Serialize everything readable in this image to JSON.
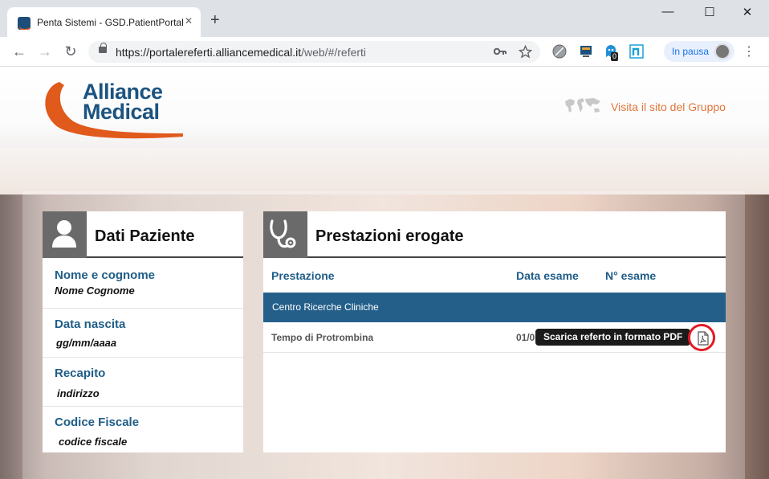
{
  "browser": {
    "tab_title": "Penta Sistemi - GSD.PatientPortal",
    "tab_close": "✕",
    "new_tab": "+",
    "url_host": "https://portalereferti.alliancemedical.it",
    "url_path": "/web/#/referti",
    "window_controls": {
      "minimize": "—",
      "maximize": "☐",
      "close": "✕"
    },
    "nav": {
      "back": "←",
      "forward": "→",
      "reload": "↻"
    },
    "profile_status": "In pausa",
    "extension_badge": "0",
    "menu": "⋮"
  },
  "header": {
    "logo_line1": "Alliance",
    "logo_line2": "Medical",
    "visit_link": "Visita il sito del Gruppo"
  },
  "patient_panel": {
    "title": "Dati Paziente",
    "fields": [
      {
        "label": "Nome e cognome",
        "value": "Nome Cognome"
      },
      {
        "label": "Data nascita",
        "value": "gg/mm/aaaa"
      },
      {
        "label": "Recapito",
        "value": "indirizzo"
      },
      {
        "label": "Codice Fiscale",
        "value": "codice fiscale"
      }
    ]
  },
  "services_panel": {
    "title": "Prestazioni erogate",
    "columns": [
      "Prestazione",
      "Data esame",
      "N° esame"
    ],
    "group": "Centro Ricerche Cliniche",
    "rows": [
      {
        "service": "Tempo di Protrombina",
        "date_partial": "01/0"
      }
    ],
    "tooltip": "Scarica referto in formato PDF"
  },
  "colors": {
    "brand_blue": "#1c5380",
    "brand_orange": "#e05a1c",
    "group_row": "#245f8a",
    "highlight_ring": "#e21b24"
  }
}
